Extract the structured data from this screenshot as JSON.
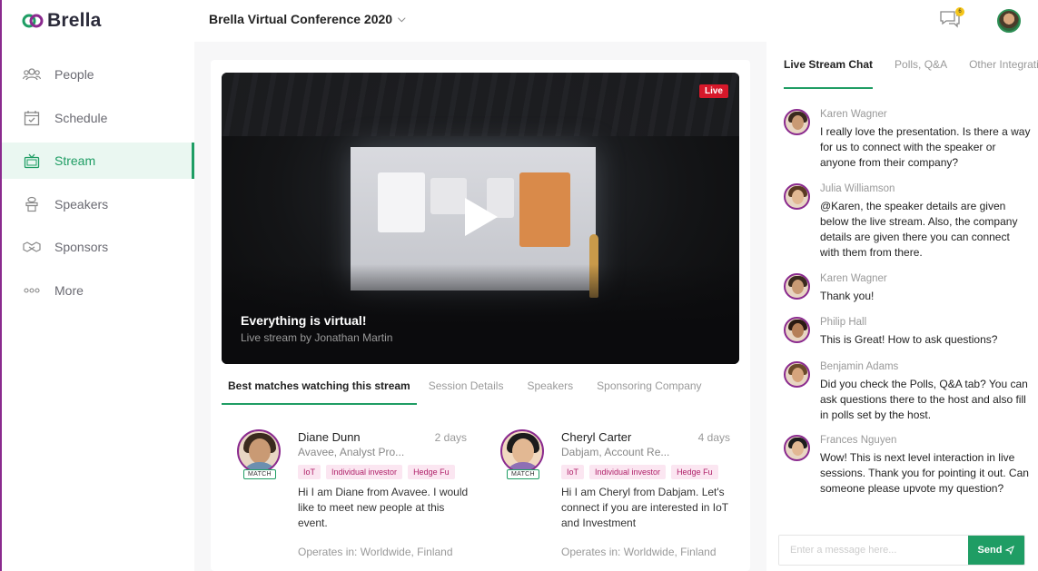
{
  "brand": {
    "name": "Brella",
    "accent": "#1f9d64",
    "frame": "#8a2a8e"
  },
  "sidebar": {
    "items": [
      {
        "label": "People",
        "icon": "people-icon",
        "active": false
      },
      {
        "label": "Schedule",
        "icon": "calendar-icon",
        "active": false
      },
      {
        "label": "Stream",
        "icon": "tv-icon",
        "active": true
      },
      {
        "label": "Speakers",
        "icon": "podium-icon",
        "active": false
      },
      {
        "label": "Sponsors",
        "icon": "handshake-icon",
        "active": false
      },
      {
        "label": "More",
        "icon": "more-icon",
        "active": false
      }
    ]
  },
  "header": {
    "event_title": "Brella Virtual Conference 2020",
    "notifications": "6"
  },
  "video": {
    "live_label": "Live",
    "title": "Everything is virtual!",
    "subtitle": "Live stream by Jonathan Martin"
  },
  "stream_tabs": [
    "Best matches watching this stream",
    "Session Details",
    "Speakers",
    "Sponsoring Company"
  ],
  "matches": [
    {
      "name": "Diane Dunn",
      "time": "2 days",
      "role": "Avavee, Analyst Pro...",
      "match_label": "MATCH",
      "tags": [
        "IoT",
        "Individual investor",
        "Hedge Fu"
      ],
      "message": "Hi I am Diane from Avavee. I would like to meet new people at this event.",
      "operates": "Operates in: Worldwide, Finland"
    },
    {
      "name": "Cheryl Carter",
      "time": "4 days",
      "role": "Dabjam, Account Re...",
      "match_label": "MATCH",
      "tags": [
        "IoT",
        "Individual investor",
        "Hedge Fu"
      ],
      "message": "Hi I am Cheryl from Dabjam. Let's connect if you are interested in IoT and Investment",
      "operates": "Operates in: Worldwide, Finland"
    }
  ],
  "chat": {
    "tabs": [
      "Live Stream Chat",
      "Polls, Q&A",
      "Other Integratio"
    ],
    "messages": [
      {
        "name": "Karen Wagner",
        "text": "I really love the presentation. Is there a way for us to connect with the speaker or anyone from their company?"
      },
      {
        "name": "Julia Williamson",
        "text": "@Karen, the speaker details are given below the live stream. Also, the company details are given there you can connect with them from there."
      },
      {
        "name": "Karen Wagner",
        "text": "Thank you!"
      },
      {
        "name": "Philip Hall",
        "text": "This is Great! How to ask questions?"
      },
      {
        "name": "Benjamin Adams",
        "text": "Did you check the Polls, Q&A tab? You can ask questions there to the host and also fill in polls set by the host."
      },
      {
        "name": "Frances Nguyen",
        "text": "Wow! This is next level interaction in live sessions. Thank you for pointing it out. Can someone please upvote my question?"
      }
    ],
    "input_placeholder": "Enter a message here...",
    "send_label": "Send"
  }
}
